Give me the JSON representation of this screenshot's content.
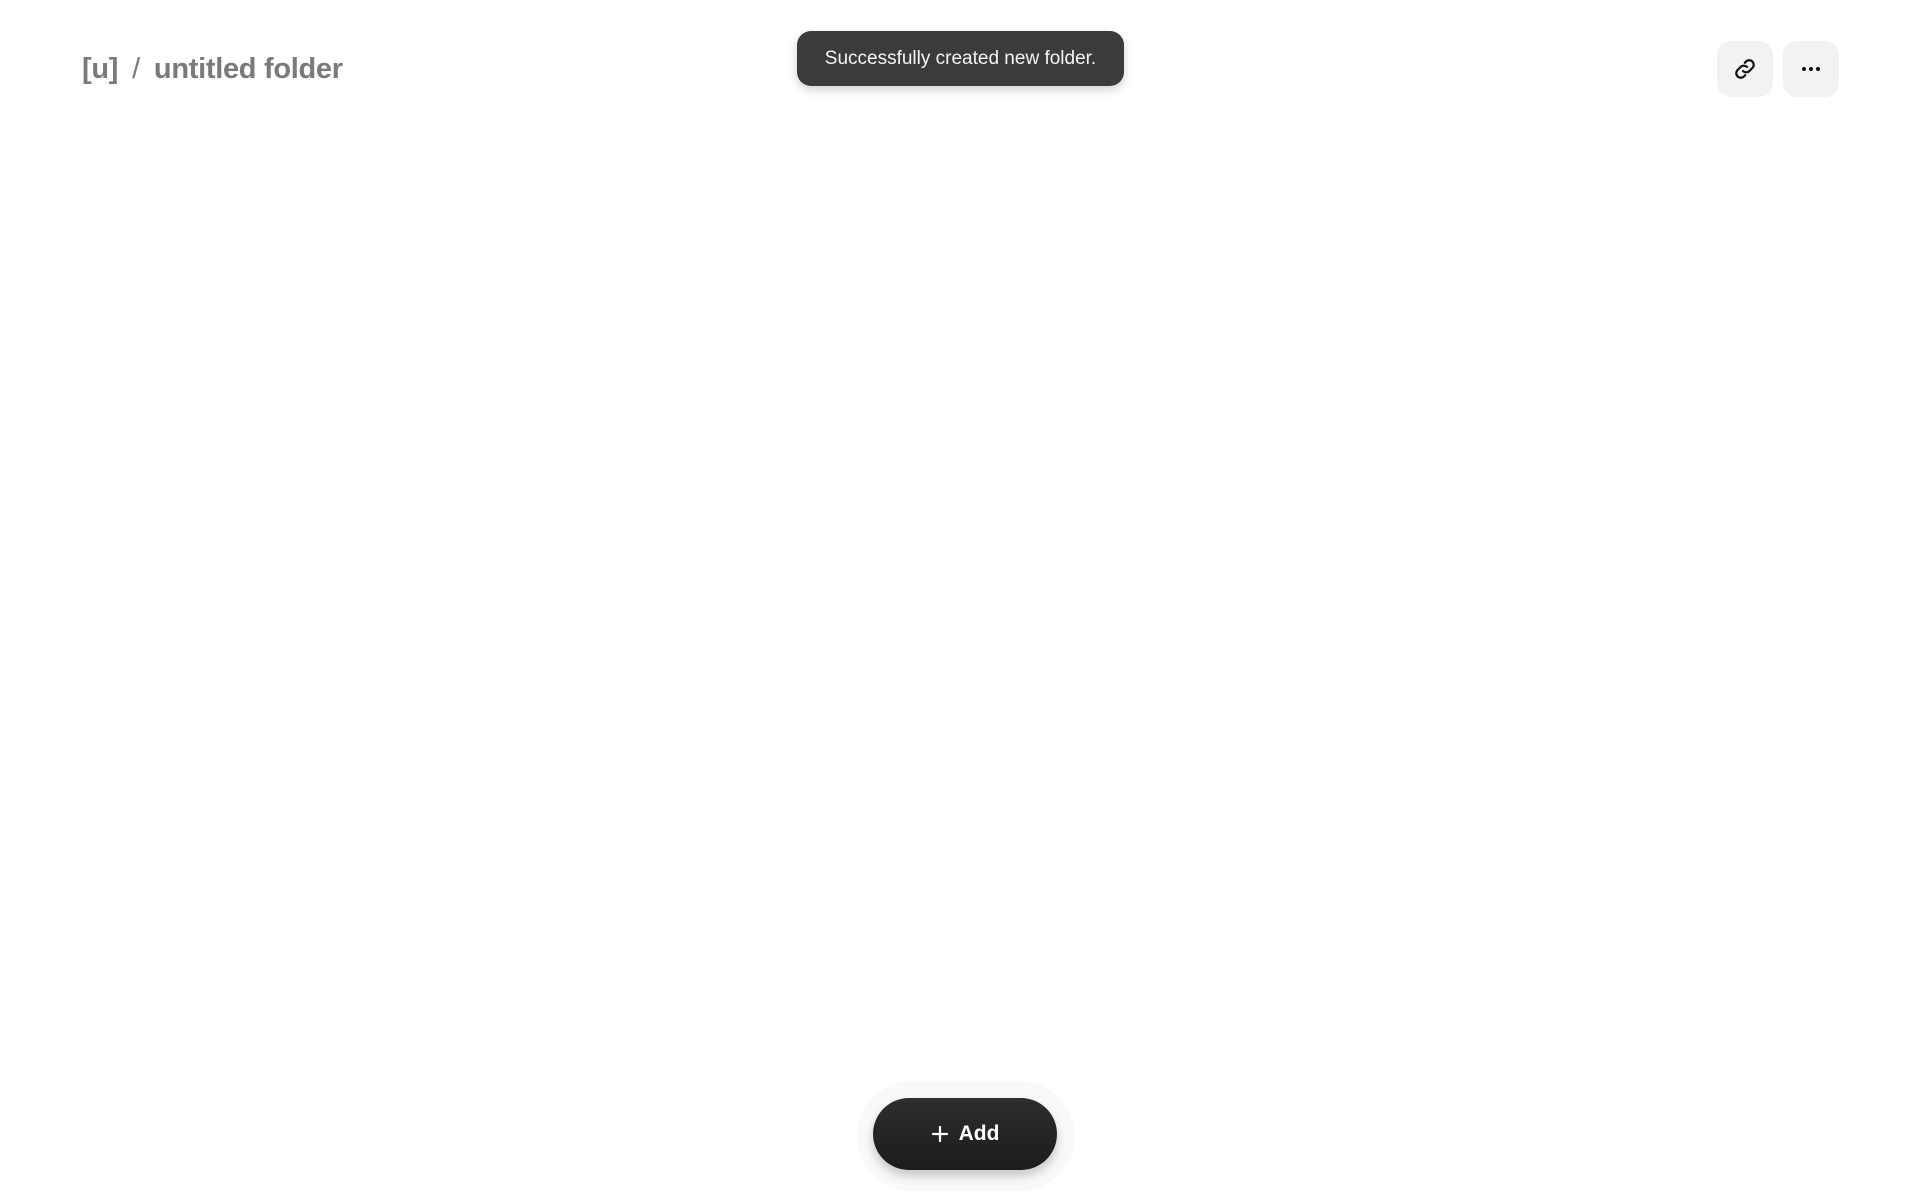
{
  "breadcrumb": {
    "root": "[u]",
    "separator": "/",
    "current": "untitled folder"
  },
  "toast": {
    "message": "Successfully created new folder."
  },
  "actions": {
    "link_icon": "link-icon",
    "more_icon": "more-horizontal-icon"
  },
  "add_button": {
    "icon": "plus-icon",
    "label": "Add"
  },
  "colors": {
    "background": "#ffffff",
    "breadcrumb_text": "#7a7a7a",
    "toast_bg": "#3b3b3b",
    "icon_button_bg": "#f2f2f2",
    "add_button_bg": "#222222"
  }
}
